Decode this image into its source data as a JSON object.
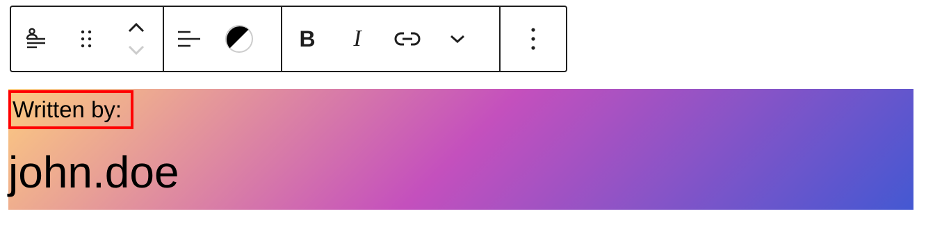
{
  "toolbar": {
    "groups": [
      {
        "name": "block-tools",
        "items": [
          {
            "icon": "post-author-icon"
          },
          {
            "icon": "drag-handle-icon"
          },
          {
            "icon": "move-up-icon"
          },
          {
            "icon": "move-down-icon"
          }
        ]
      },
      {
        "name": "layout-tools",
        "items": [
          {
            "icon": "align-left-icon"
          },
          {
            "icon": "contrast-icon"
          }
        ]
      },
      {
        "name": "format-tools",
        "items": [
          {
            "icon": "bold-icon",
            "label": "B"
          },
          {
            "icon": "italic-icon",
            "label": "I"
          },
          {
            "icon": "link-icon"
          },
          {
            "icon": "chevron-down-icon"
          }
        ]
      },
      {
        "name": "more-tools",
        "items": [
          {
            "icon": "more-options-icon"
          }
        ]
      }
    ]
  },
  "block": {
    "byline": "Written by:",
    "author": "john.doe",
    "gradient_colors": [
      "#fccb80",
      "#c450bd",
      "#4458d2"
    ],
    "highlight_color": "#ff0000"
  }
}
